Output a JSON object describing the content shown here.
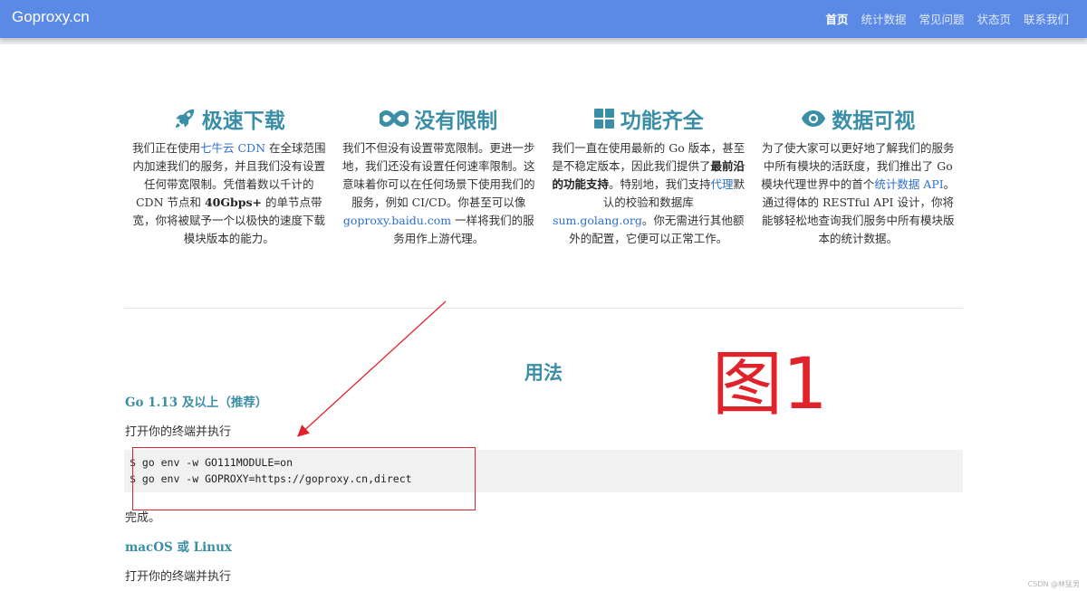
{
  "navbar": {
    "brand": "Goproxy.cn",
    "links": [
      "首页",
      "统计数据",
      "常见问题",
      "状态页",
      "联系我们"
    ],
    "active": "首页"
  },
  "features": [
    {
      "icon": "rocket-icon",
      "title": "极速下载",
      "text_parts": [
        {
          "t": "我们正在使用"
        },
        {
          "t": "七牛云 CDN",
          "link": true
        },
        {
          "t": " 在全球范围内加速我们的服务，并且我们没有设置任何带宽限制。凭借着数以千计的 CDN 节点和 "
        },
        {
          "t": "40Gbps+",
          "bold": true
        },
        {
          "t": " 的单节点带宽，你将被赋予一个以极快的速度下载模块版本的能力。"
        }
      ]
    },
    {
      "icon": "infinity-icon",
      "title": "没有限制",
      "text_parts": [
        {
          "t": "我们不但没有设置带宽限制。更进一步地，我们还没有设置任何速率限制。这意味着你可以在任何场景下使用我们的服务，例如 CI/CD。你甚至可以像 "
        },
        {
          "t": "goproxy.baidu.com",
          "link": true
        },
        {
          "t": " 一样将我们的服务用作上游代理。"
        }
      ]
    },
    {
      "icon": "grid-icon",
      "title": "功能齐全",
      "text_parts": [
        {
          "t": "我们一直在使用最新的 Go 版本，甚至是不稳定版本，因此我们提供了"
        },
        {
          "t": "最前沿的功能支持",
          "bold": true
        },
        {
          "t": "。特别地，我们支持"
        },
        {
          "t": "代理",
          "link": true
        },
        {
          "t": "默认的校验和数据库 "
        },
        {
          "t": "sum.golang.org",
          "link": true
        },
        {
          "t": "。你无需进行其他额外的配置，它便可以正常工作。"
        }
      ]
    },
    {
      "icon": "eye-icon",
      "title": "数据可视",
      "text_parts": [
        {
          "t": "为了使大家可以更好地了解我们的服务中所有模块的活跃度，我们推出了 Go 模块代理世界中的首个"
        },
        {
          "t": "统计数据 API",
          "link": true
        },
        {
          "t": "。通过得体的 RESTful API 设计，你将能够轻松地查询我们服务中所有模块版本的统计数据。"
        }
      ]
    }
  ],
  "usage": {
    "title": "用法",
    "go113_heading": "Go 1.13 及以上（推荐）",
    "go113_instruction": "打开你的终端并执行",
    "code_lines": [
      "$ go env -w GO111MODULE=on",
      "$ go env -w GOPROXY=https://goproxy.cn,direct"
    ],
    "done": "完成。",
    "mac_heading": "macOS 或 Linux",
    "mac_instruction": "打开你的终端并执行"
  },
  "annotation": {
    "label": "图1",
    "color": "#e0232b"
  },
  "watermark": "CSDN @林猛男",
  "colors": {
    "navbar": "#5a8ae6",
    "accent": "#3a8ea6",
    "link": "#2f6fd0"
  }
}
